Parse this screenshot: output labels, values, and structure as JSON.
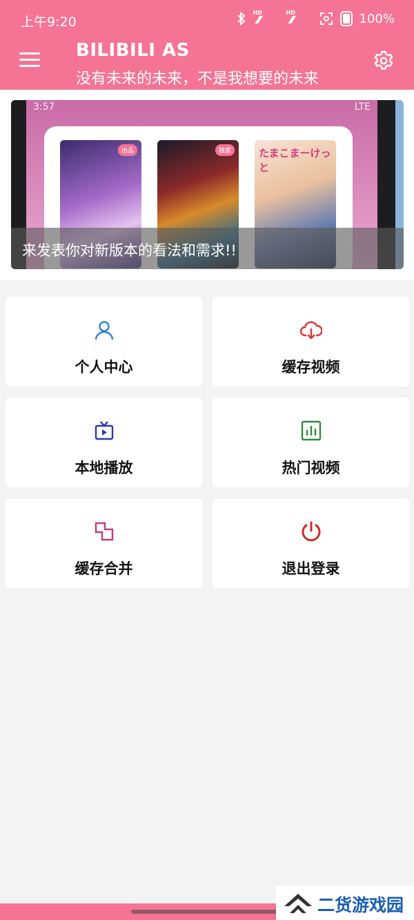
{
  "status_bar": {
    "time": "上午9:20",
    "battery": "100%",
    "signal_tag": "HD"
  },
  "app_bar": {
    "title": "BILIBILI AS",
    "subtitle": "没有未来的未来，不是我想要的未来"
  },
  "banner": {
    "caption": "来发表你对新版本的看法和需求!!",
    "phone_time": "3:57",
    "phone_network": "LTE",
    "poster_tags": [
      "出品",
      "独家"
    ],
    "poster3_text": "たまこまーけっと"
  },
  "menu": [
    {
      "label": "个人中心",
      "icon": "user-icon",
      "color": "#2f7fd8"
    },
    {
      "label": "缓存视频",
      "icon": "cloud-download-icon",
      "color": "#d8372f"
    },
    {
      "label": "本地播放",
      "icon": "tv-play-icon",
      "color": "#2b3aa8"
    },
    {
      "label": "热门视频",
      "icon": "chart-bars-icon",
      "color": "#2e8b3c"
    },
    {
      "label": "缓存合并",
      "icon": "merge-squares-icon",
      "color": "#c23a85"
    },
    {
      "label": "退出登录",
      "icon": "power-icon",
      "color": "#cc2b23"
    }
  ],
  "watermark": {
    "text": "二货游戏园"
  },
  "colors": {
    "accent": "#f57495",
    "background": "#f3f3f3"
  }
}
